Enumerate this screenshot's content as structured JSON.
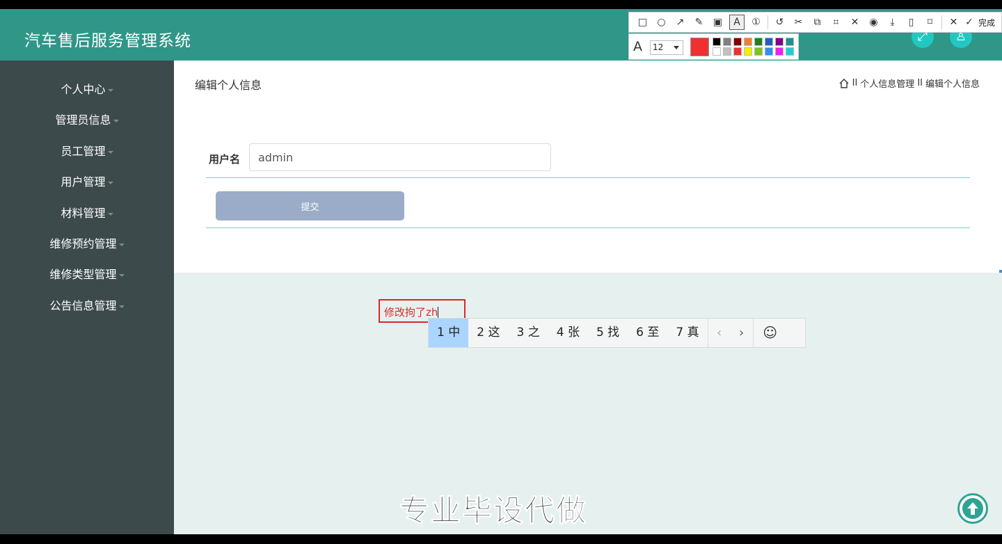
{
  "header": {
    "title": "汽车售后服务管理系统",
    "fullscreen_icon": "expand-icon",
    "user_icon": "user-icon"
  },
  "sidebar": {
    "items": [
      {
        "label": "个人中心"
      },
      {
        "label": "管理员信息"
      },
      {
        "label": "员工管理"
      },
      {
        "label": "用户管理"
      },
      {
        "label": "材料管理"
      },
      {
        "label": "维修预约管理"
      },
      {
        "label": "维修类型管理"
      },
      {
        "label": "公告信息管理"
      }
    ]
  },
  "main": {
    "page_title": "编辑个人信息",
    "breadcrumb": {
      "home_icon": "home-icon",
      "separator": "II",
      "items": [
        "个人信息管理",
        "编辑个人信息"
      ]
    },
    "form": {
      "username_label": "用户名",
      "username_value": "admin",
      "submit_label": "提交"
    }
  },
  "annotation": {
    "text": "修改拘了zh"
  },
  "ime": {
    "candidates": [
      {
        "num": "1",
        "char": "中"
      },
      {
        "num": "2",
        "char": "这"
      },
      {
        "num": "3",
        "char": "之"
      },
      {
        "num": "4",
        "char": "张"
      },
      {
        "num": "5",
        "char": "找"
      },
      {
        "num": "6",
        "char": "至"
      },
      {
        "num": "7",
        "char": "真"
      }
    ],
    "prev": "‹",
    "next": "›",
    "emoji": "☺"
  },
  "screenshot_tool": {
    "done_label": "完成",
    "font_size": "12",
    "current_color": "#f03030",
    "palette_row1": [
      "#000000",
      "#808080",
      "#800000",
      "#f08030",
      "#208020",
      "#2060c0",
      "#800080",
      "#209090"
    ],
    "palette_row2": [
      "#ffffff",
      "#c0c0c0",
      "#f03030",
      "#f0f000",
      "#80c020",
      "#3090f0",
      "#f020f0",
      "#20d0d0"
    ]
  },
  "watermark": "专业毕设代做"
}
